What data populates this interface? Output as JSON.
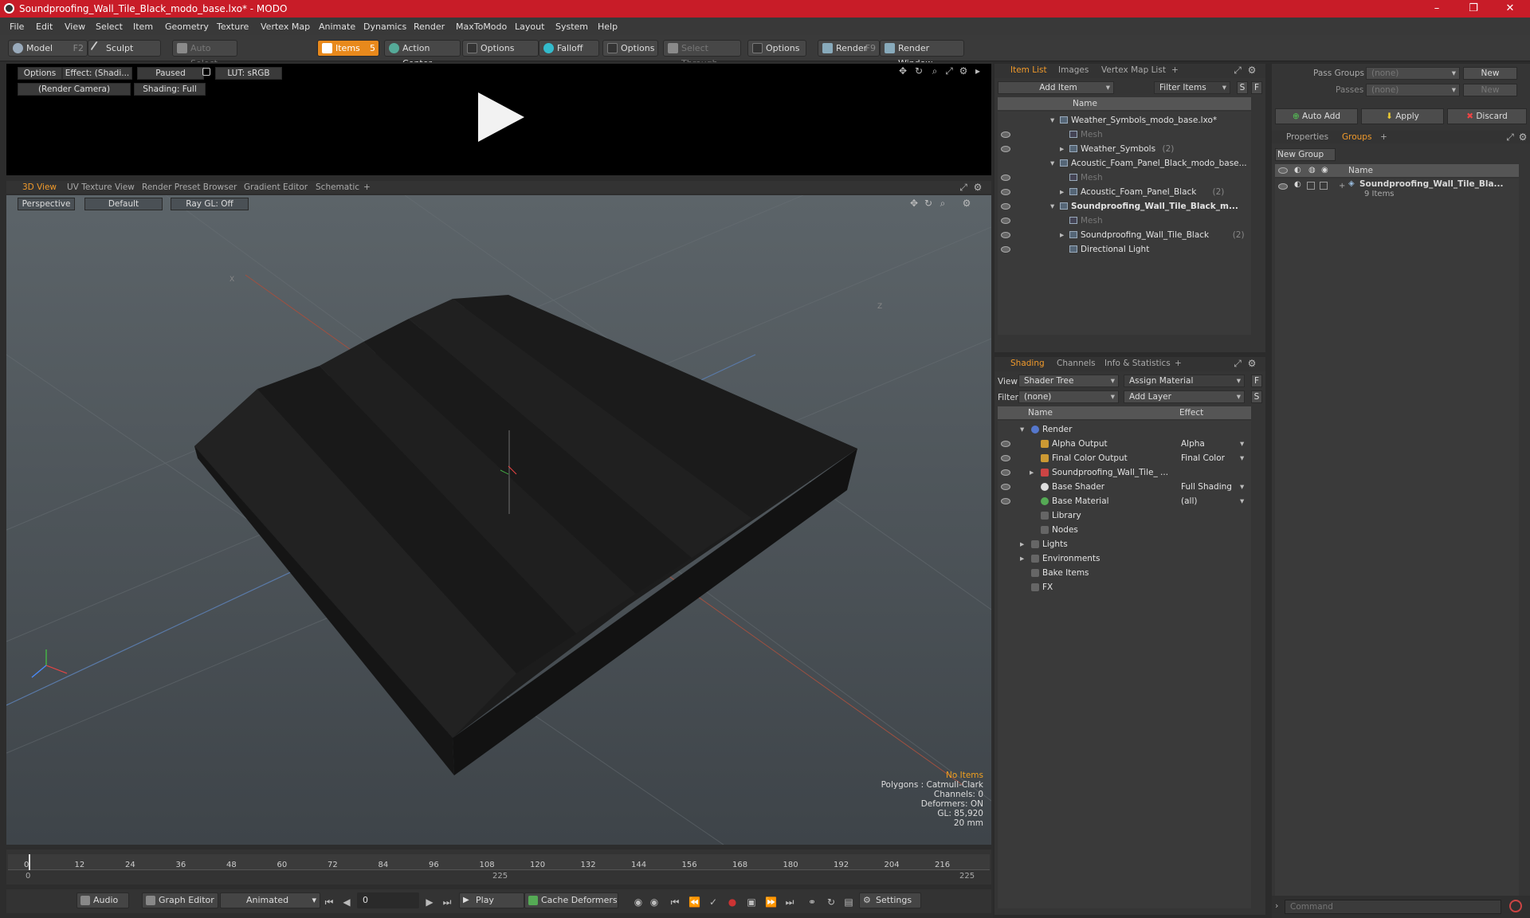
{
  "window": {
    "title": "Soundproofing_Wall_Tile_Black_modo_base.lxo* - MODO",
    "minimize": "–",
    "maximize": "❐",
    "close": "✕"
  },
  "menu": [
    "File",
    "Edit",
    "View",
    "Select",
    "Item",
    "Geometry",
    "Texture",
    "Vertex Map",
    "Animate",
    "Dynamics",
    "Render",
    "MaxToModo",
    "Layout",
    "System",
    "Help"
  ],
  "toolbar": {
    "model": "Model",
    "model_key": "F2",
    "sculpt": "Sculpt",
    "auto_select": "Auto Select",
    "items": "Items",
    "items_key": "5",
    "action_center": "Action Center",
    "options1": "Options",
    "falloff": "Falloff",
    "options2": "Options",
    "select_through": "Select Through",
    "options3": "Options",
    "render": "Render",
    "render_key": "F9",
    "render_window": "Render Window"
  },
  "preview": {
    "options": "Options",
    "effect": "Effect: (Shadi...",
    "paused": "Paused",
    "lut": "LUT: sRGB",
    "camera": "(Render Camera)",
    "shading": "Shading: Full"
  },
  "viewport_tabs": [
    "3D View",
    "UV Texture View",
    "Render Preset Browser",
    "Gradient Editor",
    "Schematic",
    "+"
  ],
  "viewport": {
    "perspective": "Perspective",
    "default": "Default",
    "raygl": "Ray GL: Off",
    "axis_x": "X",
    "axis_z": "Z"
  },
  "overlay": {
    "no_items": "No Items",
    "polygons": "Polygons : Catmull-Clark",
    "channels": "Channels: 0",
    "deformers": "Deformers: ON",
    "gl": "GL: 85,920",
    "size": "20 mm"
  },
  "timeline": {
    "ticks": [
      "0",
      "12",
      "24",
      "36",
      "48",
      "60",
      "72",
      "84",
      "96",
      "108",
      "120",
      "132",
      "144",
      "156",
      "168",
      "180",
      "192",
      "204",
      "216"
    ],
    "start": "0",
    "mid": "225",
    "end": "225"
  },
  "bottombar": {
    "audio": "Audio",
    "graph_editor": "Graph Editor",
    "animated": "Animated",
    "frame": "0",
    "play": "Play",
    "cache": "Cache Deformers",
    "settings": "Settings"
  },
  "itemlist": {
    "tabs": [
      "Item List",
      "Images",
      "Vertex Map List",
      "+"
    ],
    "add_item": "Add Item",
    "filter": "Filter Items",
    "s": "S",
    "f": "F",
    "col_name": "Name",
    "rows": [
      {
        "label": "Weather_Symbols_modo_base.lxo*",
        "count": "",
        "bold": false,
        "dim": false,
        "indent": 0,
        "arrow": "▾",
        "eye": false
      },
      {
        "label": "Mesh",
        "count": "",
        "bold": false,
        "dim": true,
        "indent": 1,
        "arrow": "",
        "eye": true
      },
      {
        "label": "Weather_Symbols",
        "count": "(2)",
        "bold": false,
        "dim": false,
        "indent": 1,
        "arrow": "▸",
        "eye": true
      },
      {
        "label": "Acoustic_Foam_Panel_Black_modo_base...",
        "count": "",
        "bold": false,
        "dim": false,
        "indent": 0,
        "arrow": "▾",
        "eye": false
      },
      {
        "label": "Mesh",
        "count": "",
        "bold": false,
        "dim": true,
        "indent": 1,
        "arrow": "",
        "eye": true
      },
      {
        "label": "Acoustic_Foam_Panel_Black",
        "count": "(2)",
        "bold": false,
        "dim": false,
        "indent": 1,
        "arrow": "▸",
        "eye": true
      },
      {
        "label": "Soundproofing_Wall_Tile_Black_m...",
        "count": "",
        "bold": true,
        "dim": false,
        "indent": 0,
        "arrow": "▾",
        "eye": true
      },
      {
        "label": "Mesh",
        "count": "",
        "bold": false,
        "dim": true,
        "indent": 1,
        "arrow": "",
        "eye": true
      },
      {
        "label": "Soundproofing_Wall_Tile_Black",
        "count": "(2)",
        "bold": false,
        "dim": false,
        "indent": 1,
        "arrow": "▸",
        "eye": true
      },
      {
        "label": "Directional Light",
        "count": "",
        "bold": false,
        "dim": false,
        "indent": 1,
        "arrow": "",
        "eye": true
      }
    ]
  },
  "shading": {
    "tabs": [
      "Shading",
      "Channels",
      "Info & Statistics",
      "+"
    ],
    "view_label": "View",
    "view_value": "Shader Tree",
    "assign": "Assign Material",
    "f": "F",
    "filter_label": "Filter",
    "filter_value": "(none)",
    "add_layer": "Add Layer",
    "s": "S",
    "col_name": "Name",
    "col_effect": "Effect",
    "rows": [
      {
        "label": "Render",
        "effect": "",
        "indent": 0,
        "arrow": "▾",
        "eye": false
      },
      {
        "label": "Alpha Output",
        "effect": "Alpha",
        "indent": 1,
        "arrow": "",
        "eye": true
      },
      {
        "label": "Final Color Output",
        "effect": "Final Color",
        "indent": 1,
        "arrow": "",
        "eye": true
      },
      {
        "label": "Soundproofing_Wall_Tile_ ...",
        "effect": "",
        "indent": 1,
        "arrow": "▸",
        "eye": true
      },
      {
        "label": "Base Shader",
        "effect": "Full Shading",
        "indent": 1,
        "arrow": "",
        "eye": true
      },
      {
        "label": "Base Material",
        "effect": "(all)",
        "indent": 1,
        "arrow": "",
        "eye": true
      },
      {
        "label": "Library",
        "effect": "",
        "indent": 1,
        "arrow": "",
        "eye": false
      },
      {
        "label": "Nodes",
        "effect": "",
        "indent": 1,
        "arrow": "",
        "eye": false
      },
      {
        "label": "Lights",
        "effect": "",
        "indent": 0,
        "arrow": "▸",
        "eye": false
      },
      {
        "label": "Environments",
        "effect": "",
        "indent": 0,
        "arrow": "▸",
        "eye": false
      },
      {
        "label": "Bake Items",
        "effect": "",
        "indent": 0,
        "arrow": "",
        "eye": false
      },
      {
        "label": "FX",
        "effect": "",
        "indent": 0,
        "arrow": "",
        "eye": false
      }
    ]
  },
  "groups": {
    "pass_groups": "Pass Groups",
    "passes": "Passes",
    "none": "(none)",
    "new": "New",
    "auto_add": "Auto Add",
    "apply": "Apply",
    "discard": "Discard",
    "tabs": [
      "Properties",
      "Groups",
      "+"
    ],
    "new_group": "New Group",
    "col_name": "Name",
    "item_name": "Soundproofing_Wall_Tile_Bla...",
    "item_count": "9 Items"
  },
  "command": {
    "placeholder": "Command"
  }
}
